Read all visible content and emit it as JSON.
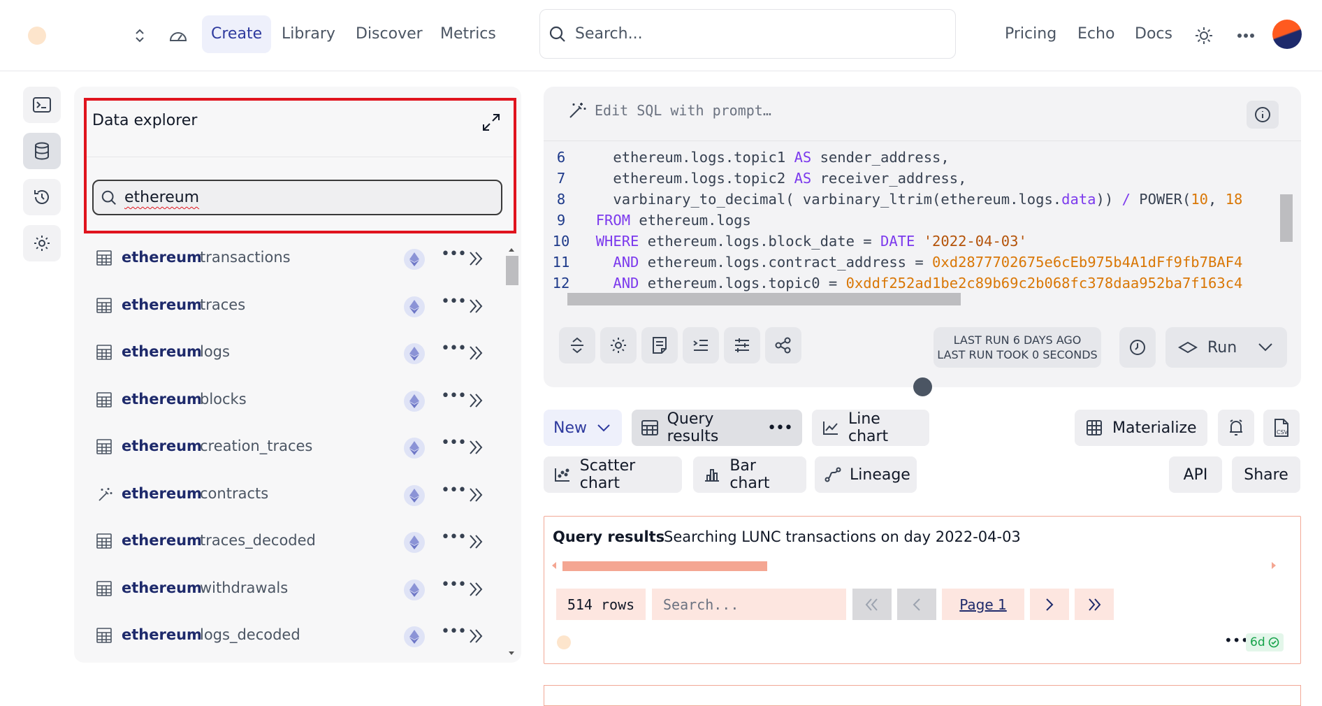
{
  "nav": {
    "items": [
      {
        "label": "Create",
        "active": true
      },
      {
        "label": "Library"
      },
      {
        "label": "Discover"
      },
      {
        "label": "Metrics"
      }
    ],
    "search_placeholder": "Search...",
    "links": [
      "Pricing",
      "Echo",
      "Docs"
    ]
  },
  "explorer": {
    "title": "Data explorer",
    "search_value": "ethereum",
    "tables": [
      {
        "schema": "ethereum",
        "name": "transactions",
        "icon": "table-icon"
      },
      {
        "schema": "ethereum",
        "name": "traces",
        "icon": "table-icon"
      },
      {
        "schema": "ethereum",
        "name": "logs",
        "icon": "table-icon"
      },
      {
        "schema": "ethereum",
        "name": "blocks",
        "icon": "table-icon"
      },
      {
        "schema": "ethereum",
        "name": "creation_traces",
        "icon": "table-icon"
      },
      {
        "schema": "ethereum",
        "name": "contracts",
        "icon": "magic-wand-icon"
      },
      {
        "schema": "ethereum",
        "name": "traces_decoded",
        "icon": "table-icon"
      },
      {
        "schema": "ethereum",
        "name": "withdrawals",
        "icon": "table-icon"
      },
      {
        "schema": "ethereum",
        "name": "logs_decoded",
        "icon": "table-icon"
      }
    ]
  },
  "editor": {
    "prompt_placeholder": "Edit SQL with prompt…",
    "lines": [
      {
        "n": "6",
        "t": "    ethereum.logs.topic1 AS sender_address,"
      },
      {
        "n": "7",
        "t": "    ethereum.logs.topic2 AS receiver_address,"
      },
      {
        "n": "8",
        "t": "    varbinary_to_decimal( varbinary_ltrim(ethereum.logs.data)) / POWER(10, 18"
      },
      {
        "n": "9",
        "t": "  FROM ethereum.logs"
      },
      {
        "n": "10",
        "t": "  WHERE ethereum.logs.block_date = DATE '2022-04-03'"
      },
      {
        "n": "11",
        "t": "    AND ethereum.logs.contract_address = 0xd2877702675e6cEb975b4A1dFf9fb7BAF4"
      },
      {
        "n": "12",
        "t": "    AND ethereum.logs.topic0 = 0xddf252ad1be2c89b69c2b068fc378daa952ba7f163c4"
      }
    ],
    "last_run_line1": "LAST RUN 6 DAYS AGO",
    "last_run_line2": "LAST RUN TOOK 0 SECONDS",
    "run_label": "Run"
  },
  "viz": {
    "new_label": "New",
    "query_results_label": "Query results",
    "line_chart_label": "Line chart",
    "materialize_label": "Materialize",
    "scatter_label": "Scatter chart",
    "bar_label": "Bar chart",
    "lineage_label": "Lineage",
    "api_label": "API",
    "share_label": "Share"
  },
  "results": {
    "title": "Query results",
    "subtitle": "Searching LUNC transactions on day 2022-04-03",
    "rows": "514 rows",
    "search_placeholder": "Search...",
    "page_label": "Page 1",
    "age": "6d"
  }
}
